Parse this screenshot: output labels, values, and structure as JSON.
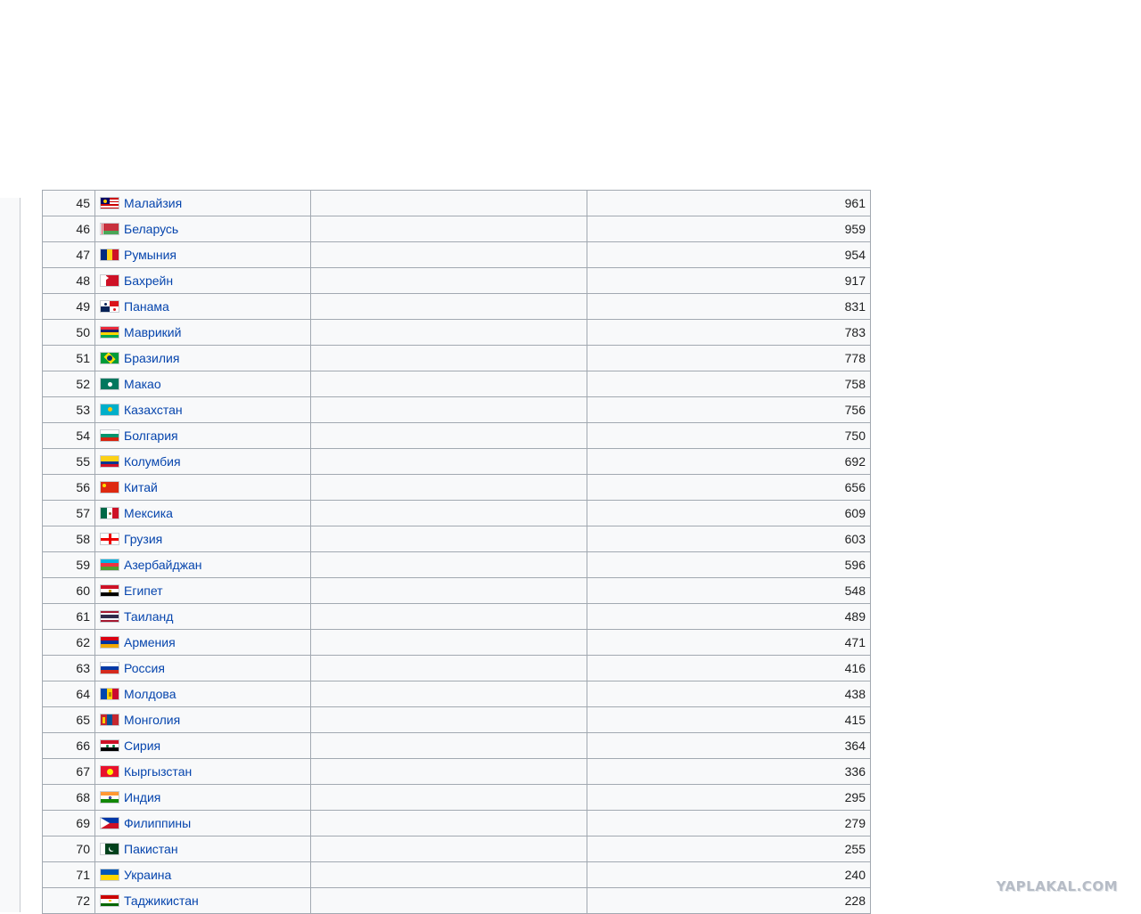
{
  "table": {
    "rows": [
      {
        "rank": "45",
        "country": "Малайзия",
        "value": "961",
        "flag": "malaysia-flag-icon"
      },
      {
        "rank": "46",
        "country": "Беларусь",
        "value": "959",
        "flag": "belarus-flag-icon"
      },
      {
        "rank": "47",
        "country": "Румыния",
        "value": "954",
        "flag": "romania-flag-icon"
      },
      {
        "rank": "48",
        "country": "Бахрейн",
        "value": "917",
        "flag": "bahrain-flag-icon"
      },
      {
        "rank": "49",
        "country": "Панама",
        "value": "831",
        "flag": "panama-flag-icon"
      },
      {
        "rank": "50",
        "country": "Маврикий",
        "value": "783",
        "flag": "mauritius-flag-icon"
      },
      {
        "rank": "51",
        "country": "Бразилия",
        "value": "778",
        "flag": "brazil-flag-icon"
      },
      {
        "rank": "52",
        "country": "Макао",
        "value": "758",
        "flag": "macao-flag-icon"
      },
      {
        "rank": "53",
        "country": "Казахстан",
        "value": "756",
        "flag": "kazakhstan-flag-icon"
      },
      {
        "rank": "54",
        "country": "Болгария",
        "value": "750",
        "flag": "bulgaria-flag-icon"
      },
      {
        "rank": "55",
        "country": "Колумбия",
        "value": "692",
        "flag": "colombia-flag-icon"
      },
      {
        "rank": "56",
        "country": "Китай",
        "value": "656",
        "flag": "china-flag-icon"
      },
      {
        "rank": "57",
        "country": "Мексика",
        "value": "609",
        "flag": "mexico-flag-icon"
      },
      {
        "rank": "58",
        "country": "Грузия",
        "value": "603",
        "flag": "georgia-flag-icon"
      },
      {
        "rank": "59",
        "country": "Азербайджан",
        "value": "596",
        "flag": "azerbaijan-flag-icon"
      },
      {
        "rank": "60",
        "country": "Египет",
        "value": "548",
        "flag": "egypt-flag-icon"
      },
      {
        "rank": "61",
        "country": "Таиланд",
        "value": "489",
        "flag": "thailand-flag-icon"
      },
      {
        "rank": "62",
        "country": "Армения",
        "value": "471",
        "flag": "armenia-flag-icon"
      },
      {
        "rank": "63",
        "country": "Россия",
        "value": "416",
        "flag": "russia-flag-icon"
      },
      {
        "rank": "64",
        "country": "Молдова",
        "value": "438",
        "flag": "moldova-flag-icon"
      },
      {
        "rank": "65",
        "country": "Монголия",
        "value": "415",
        "flag": "mongolia-flag-icon"
      },
      {
        "rank": "66",
        "country": "Сирия",
        "value": "364",
        "flag": "syria-flag-icon"
      },
      {
        "rank": "67",
        "country": "Кыргызстан",
        "value": "336",
        "flag": "kyrgyzstan-flag-icon"
      },
      {
        "rank": "68",
        "country": "Индия",
        "value": "295",
        "flag": "india-flag-icon"
      },
      {
        "rank": "69",
        "country": "Филиппины",
        "value": "279",
        "flag": "philippines-flag-icon"
      },
      {
        "rank": "70",
        "country": "Пакистан",
        "value": "255",
        "flag": "pakistan-flag-icon"
      },
      {
        "rank": "71",
        "country": "Украина",
        "value": "240",
        "flag": "ukraine-flag-icon"
      },
      {
        "rank": "72",
        "country": "Таджикистан",
        "value": "228",
        "flag": "tajikistan-flag-icon"
      }
    ]
  },
  "watermark": "YAPLAKAL.COM",
  "colors": {
    "link": "#0645ad",
    "row_bg": "#f8f9fa",
    "border": "#a2a9b1",
    "watermark": "#b6bcc6"
  }
}
